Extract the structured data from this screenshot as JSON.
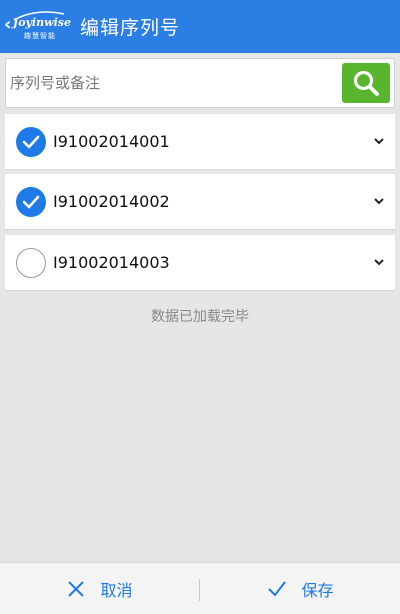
{
  "header": {
    "back_icon": "chevron-left-icon",
    "logo_text": "Joyinwise",
    "logo_sub": "趣慧智能",
    "title": "编辑序列号"
  },
  "search": {
    "placeholder": "序列号或备注",
    "value": "",
    "button_icon": "search-icon"
  },
  "items": [
    {
      "serial": "I91002014001",
      "checked": true
    },
    {
      "serial": "I91002014002",
      "checked": true
    },
    {
      "serial": "I91002014003",
      "checked": false
    }
  ],
  "status": {
    "loaded_text": "数据已加载完毕"
  },
  "footer": {
    "cancel_label": "取消",
    "cancel_icon": "close-icon",
    "save_label": "保存",
    "save_icon": "checkmark-icon"
  },
  "colors": {
    "header_bg": "#2b7ee4",
    "accent": "#1e7ae6",
    "search_button": "#5ab52e",
    "background": "#e6e6e6"
  }
}
